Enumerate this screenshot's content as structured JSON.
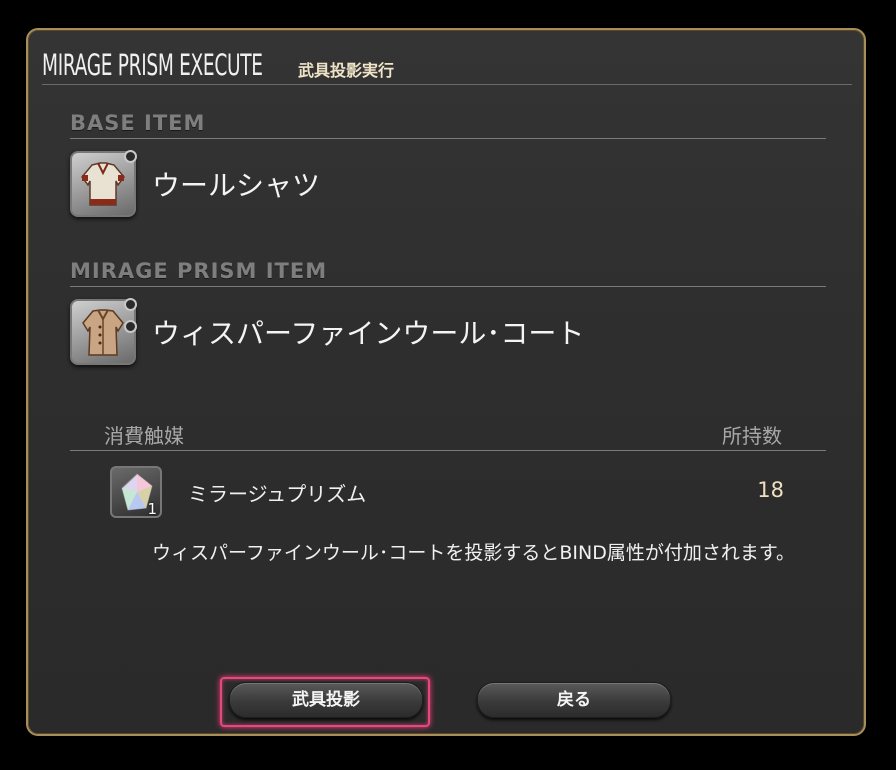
{
  "window": {
    "title_en": "MIRAGE PRISM EXECUTE",
    "title_jp": "武具投影実行"
  },
  "base_item": {
    "section_label": "BASE ITEM",
    "name": "ウールシャツ",
    "icon": "wool-shirt-icon"
  },
  "mirage_item": {
    "section_label": "MIRAGE PRISM ITEM",
    "name": "ウィスパーファインウール･コート",
    "icon": "whisperfine-wool-coat-icon"
  },
  "catalyst": {
    "header_consumed": "消費触媒",
    "header_held": "所持数",
    "name": "ミラージュプリズム",
    "required": "1",
    "held": "18",
    "icon": "glamour-prism-icon"
  },
  "description": "ウィスパーファインウール･コートを投影するとBIND属性が付加されます。",
  "buttons": {
    "confirm_label": "武具投影",
    "back_label": "戻る"
  },
  "colors": {
    "frame_gold": "#a88f5a",
    "focus_ring": "#e04a7e"
  }
}
